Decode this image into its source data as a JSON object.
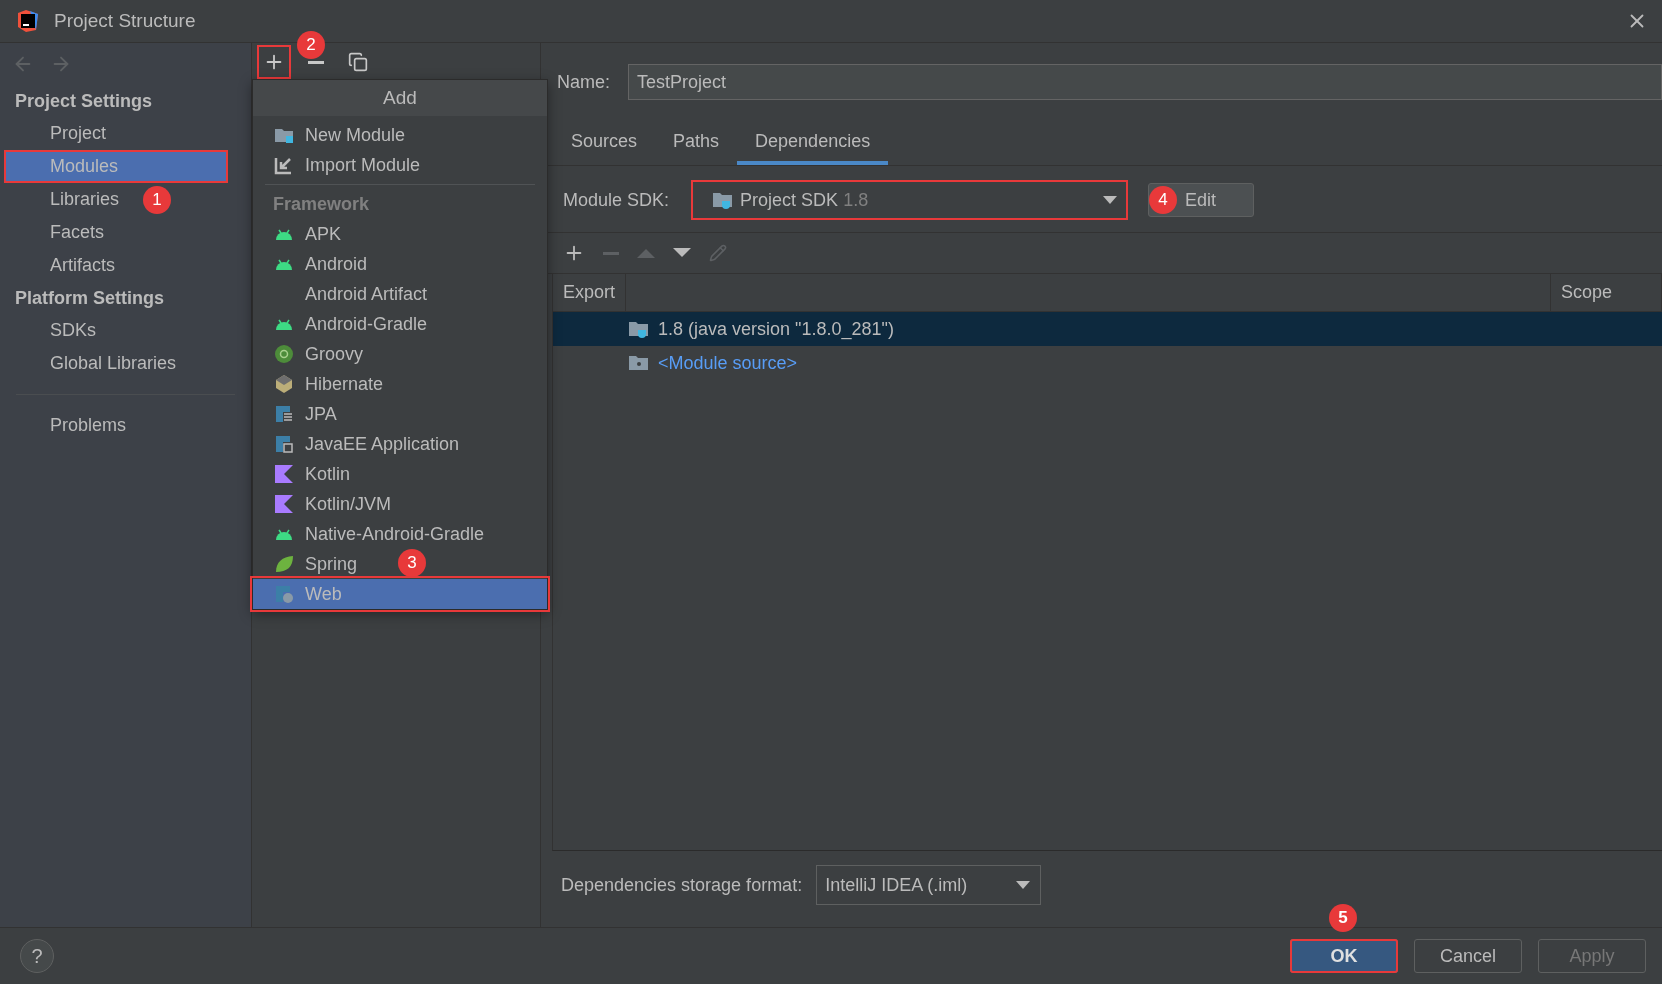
{
  "window": {
    "title": "Project Structure"
  },
  "sidebar": {
    "groups": [
      {
        "heading": "Project Settings",
        "items": [
          {
            "label": "Project",
            "selected": false,
            "outlined": false
          },
          {
            "label": "Modules",
            "selected": true,
            "outlined": true
          },
          {
            "label": "Libraries",
            "selected": false,
            "outlined": false,
            "callout": "1"
          },
          {
            "label": "Facets",
            "selected": false,
            "outlined": false
          },
          {
            "label": "Artifacts",
            "selected": false,
            "outlined": false
          }
        ]
      },
      {
        "heading": "Platform Settings",
        "items": [
          {
            "label": "SDKs",
            "selected": false,
            "outlined": false
          },
          {
            "label": "Global Libraries",
            "selected": false,
            "outlined": false
          }
        ]
      }
    ],
    "footer_items": [
      {
        "label": "Problems",
        "selected": false,
        "outlined": false
      }
    ]
  },
  "module_toolbar": [
    {
      "kind": "add",
      "outlined": true,
      "callout": "2"
    },
    {
      "kind": "remove",
      "outlined": false
    },
    {
      "kind": "copy",
      "outlined": false
    }
  ],
  "add_menu": {
    "title": "Add",
    "items": [
      {
        "kind": "folder",
        "label": "New Module",
        "selected": false,
        "outlined": false
      },
      {
        "kind": "import",
        "label": "Import Module",
        "selected": false,
        "outlined": false
      },
      {
        "kind": "separator"
      },
      {
        "kind": "header",
        "label": "Framework"
      },
      {
        "kind": "android",
        "label": "APK",
        "selected": false,
        "outlined": false
      },
      {
        "kind": "android",
        "label": "Android",
        "selected": false,
        "outlined": false
      },
      {
        "kind": "plain",
        "label": "Android Artifact",
        "selected": false,
        "outlined": false
      },
      {
        "kind": "android",
        "label": "Android-Gradle",
        "selected": false,
        "outlined": false
      },
      {
        "kind": "groovy",
        "label": "Groovy",
        "selected": false,
        "outlined": false
      },
      {
        "kind": "hibernate",
        "label": "Hibernate",
        "selected": false,
        "outlined": false
      },
      {
        "kind": "jpa",
        "label": "JPA",
        "selected": false,
        "outlined": false
      },
      {
        "kind": "javaee",
        "label": "JavaEE Application",
        "selected": false,
        "outlined": false
      },
      {
        "kind": "kotlin",
        "label": "Kotlin",
        "selected": false,
        "outlined": false
      },
      {
        "kind": "kotlin",
        "label": "Kotlin/JVM",
        "selected": false,
        "outlined": false
      },
      {
        "kind": "android",
        "label": "Native-Android-Gradle",
        "selected": false,
        "outlined": false
      },
      {
        "kind": "spring",
        "label": "Spring",
        "selected": false,
        "outlined": false
      },
      {
        "kind": "web",
        "label": "Web",
        "selected": true,
        "outlined": true,
        "callout": "3"
      }
    ]
  },
  "name_field": {
    "label": "Name:",
    "value": "TestProject"
  },
  "tabs": [
    {
      "label": "Sources",
      "selected": false
    },
    {
      "label": "Paths",
      "selected": false
    },
    {
      "label": "Dependencies",
      "selected": true
    }
  ],
  "module_sdk": {
    "label": "Module SDK:",
    "value": "Project SDK",
    "version": "1.8",
    "outlined": true
  },
  "edit_button": {
    "label": "Edit",
    "callout": "4"
  },
  "dependency_toolbar": [
    {
      "kind": "add",
      "disabled": false
    },
    {
      "kind": "remove",
      "disabled": true
    },
    {
      "kind": "up",
      "disabled": true
    },
    {
      "kind": "down",
      "disabled": false
    },
    {
      "kind": "edit",
      "disabled": true
    }
  ],
  "table": {
    "columns": [
      "Export",
      "Scope"
    ],
    "rows": [
      {
        "kind": "sdk",
        "label": "1.8 (java version \"1.8.0_281\")",
        "selected": true
      },
      {
        "kind": "source",
        "label": "<Module source>",
        "selected": false
      }
    ]
  },
  "storage_format": {
    "label": "Dependencies storage format:",
    "value": "IntelliJ IDEA (.iml)"
  },
  "help": "?",
  "footer_buttons": [
    {
      "kind": "primary",
      "label": "OK",
      "disabled": false,
      "outlined": true,
      "callout": "5"
    },
    {
      "kind": "normal",
      "label": "Cancel",
      "disabled": false,
      "outlined": false
    },
    {
      "kind": "normal",
      "label": "Apply",
      "disabled": true,
      "outlined": false
    }
  ]
}
